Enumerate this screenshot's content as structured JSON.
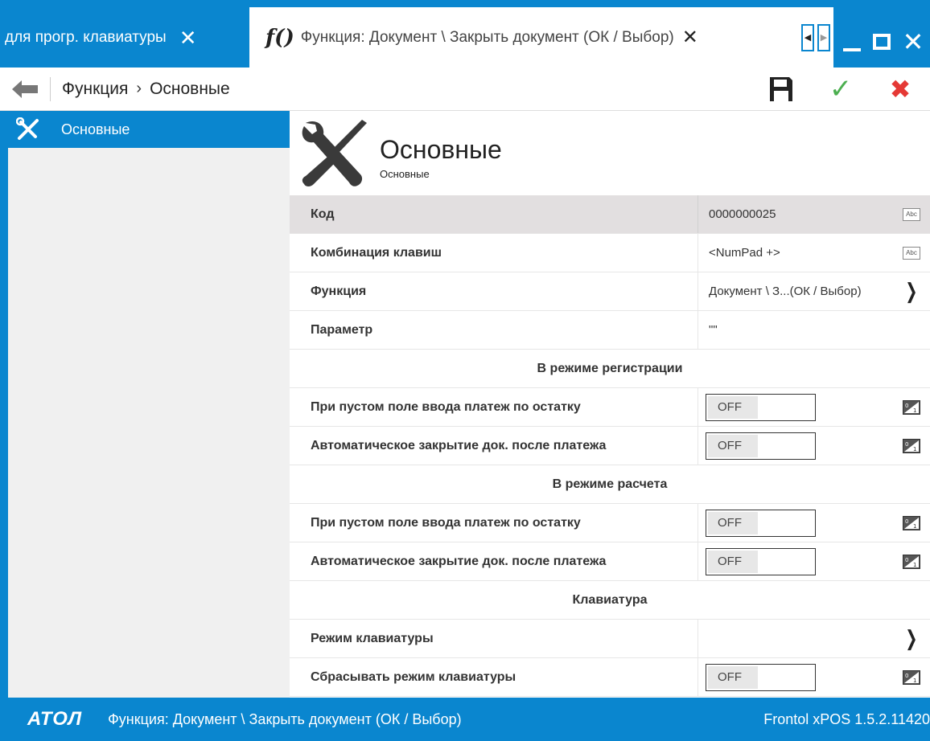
{
  "tabs": {
    "tab1_label": "для прогр. клавиатуры",
    "tab2_icon_text": "f()",
    "tab2_label": "Функция: Документ \\ Закрыть документ (ОК / Выбор)",
    "close_glyph": "✕"
  },
  "toolbar": {
    "crumb_root": "Функция",
    "crumb_sep": "›",
    "crumb_current": "Основные",
    "ok_glyph": "✓",
    "cancel_glyph": "✖"
  },
  "sidebar": {
    "items": [
      {
        "label": "Основные",
        "icon": "tools-icon"
      }
    ]
  },
  "header": {
    "title": "Основные",
    "subtitle": "Основные"
  },
  "rows": {
    "code": {
      "label": "Код",
      "value": "0000000025",
      "badge": "Abc"
    },
    "hotkey": {
      "label": "Комбинация клавиш",
      "value": "<NumPad +>",
      "badge": "Abc"
    },
    "function": {
      "label": "Функция",
      "value": "Документ \\ З...(ОК / Выбор)"
    },
    "param": {
      "label": "Параметр",
      "value": "\"\""
    }
  },
  "sections": {
    "registration": {
      "title": "В режиме регистрации",
      "empty_input": {
        "label": "При пустом поле ввода платеж по остатку",
        "value": "OFF"
      },
      "auto_close": {
        "label": "Автоматическое закрытие док. после платежа",
        "value": "OFF"
      }
    },
    "payment": {
      "title": "В режиме расчета",
      "empty_input": {
        "label": "При пустом поле ввода платеж по остатку",
        "value": "OFF"
      },
      "auto_close": {
        "label": "Автоматическое закрытие док. после платежа",
        "value": "OFF"
      }
    },
    "keyboard": {
      "title": "Клавиатура",
      "mode": {
        "label": "Режим клавиатуры"
      },
      "reset": {
        "label": "Сбрасывать режим клавиатуры",
        "value": "OFF"
      }
    }
  },
  "status": {
    "logo": "АТОЛ",
    "message": "Функция: Документ \\ Закрыть документ (ОК / Выбор)",
    "version": "Frontol xPOS 1.5.2.11420"
  },
  "colors": {
    "accent": "#0a86cf",
    "ok": "#4caf50",
    "cancel": "#e53935"
  }
}
